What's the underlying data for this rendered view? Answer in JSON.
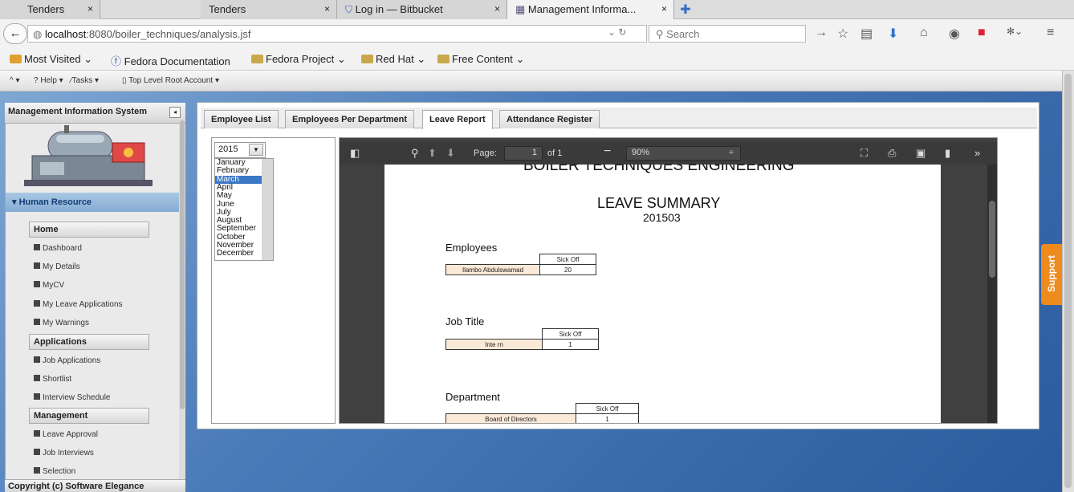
{
  "browser": {
    "tabs": [
      {
        "title": "Tenders",
        "close": "×"
      },
      {
        "title": "Tenders",
        "close": "×"
      },
      {
        "title": "Log in — Bitbucket",
        "close": "×"
      },
      {
        "title": "Management Informa...",
        "close": "×"
      }
    ],
    "url_host": "localhost",
    "url_path": ":8080/boiler_techniques/analysis.jsf",
    "search_placeholder": "Search",
    "bookmarks": [
      "Most Visited",
      "Fedora Documentation",
      "Fedora Project",
      "Red Hat",
      "Free Content"
    ]
  },
  "appmenu": {
    "help": "? Help",
    "tasks": "Tasks",
    "account": "Top Level Root Account"
  },
  "sidebar": {
    "title": "Management Information System",
    "group": "Human Resource",
    "sections": [
      {
        "label": "Home",
        "items": [
          "Dashboard",
          "My Details",
          "MyCV",
          "My Leave Applications",
          "My Warnings"
        ]
      },
      {
        "label": "Applications",
        "items": [
          "Job Applications",
          "Shortlist",
          "Interview Schedule"
        ]
      },
      {
        "label": "Management",
        "items": [
          "Leave Approval",
          "Job Interviews",
          "Selection"
        ]
      }
    ],
    "footer": "Copyright (c) Software Elegance"
  },
  "content_tabs": [
    "Employee List",
    "Employees Per Department",
    "Leave Report",
    "Attendance Register"
  ],
  "active_tab": "Leave Report",
  "filter": {
    "year": "2015",
    "months": [
      "January",
      "February",
      "March",
      "April",
      "May",
      "June",
      "July",
      "August",
      "September",
      "October",
      "November",
      "December"
    ],
    "selected_month": "March"
  },
  "pdf_viewer": {
    "page_label": "Page:",
    "page_value": "1",
    "page_of": "of 1",
    "zoom": "90%"
  },
  "report": {
    "company": "BOILER TECHNIQUES ENGINEERING",
    "title": "LEAVE SUMMARY",
    "period": "201503",
    "employees": {
      "heading": "Employees",
      "column": "Sick Off",
      "rows": [
        {
          "name": "Ilambo Abdulswamad",
          "value": "20"
        }
      ]
    },
    "job_title": {
      "heading": "Job Title",
      "column": "Sick Off",
      "rows": [
        {
          "name": "Inte rn",
          "value": "1"
        }
      ]
    },
    "department": {
      "heading": "Department",
      "column": "Sick Off",
      "rows": [
        {
          "name": "Board of Directors",
          "value": "1"
        }
      ]
    }
  },
  "support_label": "Support",
  "colors": {
    "accent_blue": "#3a78c6",
    "support_orange": "#ef8a1c",
    "pdf_toolbar": "#3a3a3a"
  }
}
